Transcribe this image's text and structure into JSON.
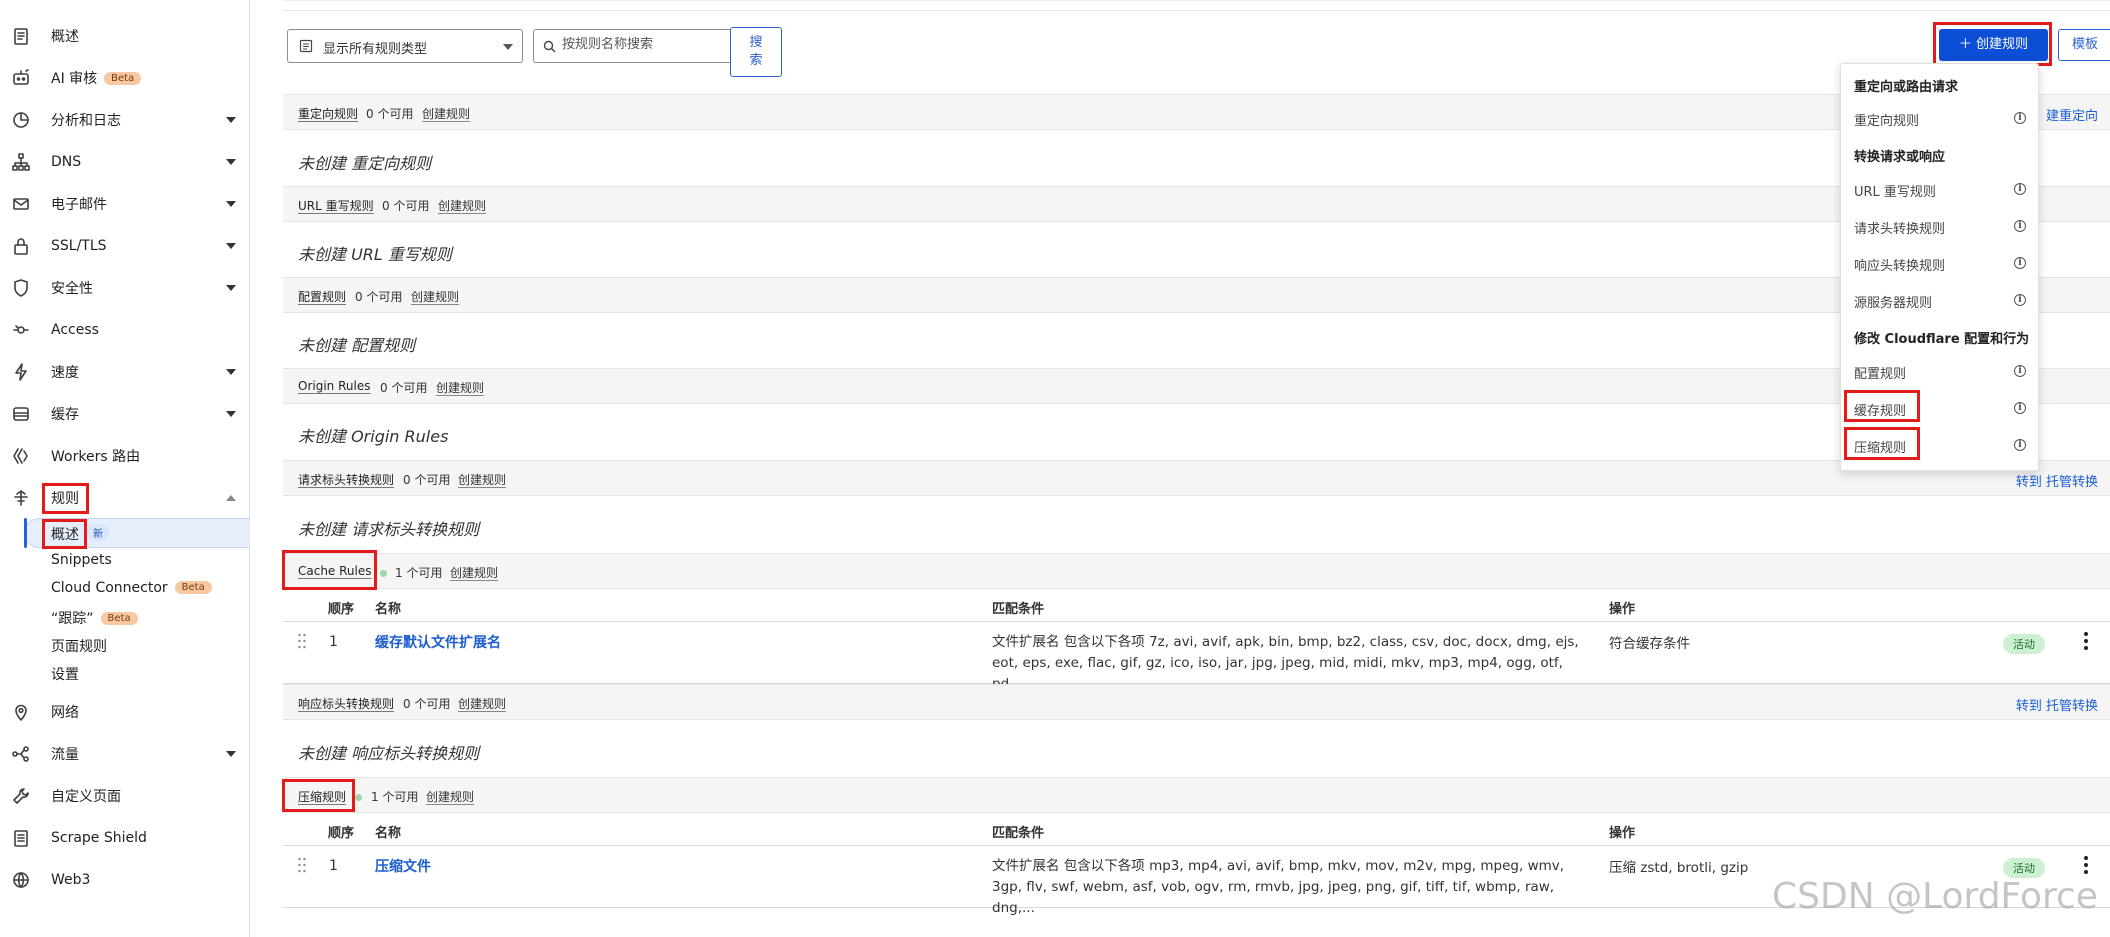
{
  "sidebar": {
    "items": [
      {
        "label": "概述"
      },
      {
        "label": "AI 审核",
        "badge": "Beta"
      },
      {
        "label": "分析和日志"
      },
      {
        "label": "DNS"
      },
      {
        "label": "电子邮件"
      },
      {
        "label": "SSL/TLS"
      },
      {
        "label": "安全性"
      },
      {
        "label": "Access"
      },
      {
        "label": "速度"
      },
      {
        "label": "缓存"
      },
      {
        "label": "Workers 路由"
      },
      {
        "label": "规则"
      },
      {
        "label": "网络"
      },
      {
        "label": "流量"
      },
      {
        "label": "自定义页面"
      },
      {
        "label": "Scrape Shield"
      },
      {
        "label": "Web3"
      }
    ],
    "rules_sub": [
      {
        "label": "概述",
        "badge": "新"
      },
      {
        "label": "Snippets"
      },
      {
        "label": "Cloud Connector",
        "badge": "Beta"
      },
      {
        "label": "“跟踪”",
        "badge": "Beta"
      },
      {
        "label": "页面规则"
      },
      {
        "label": "设置"
      }
    ]
  },
  "toolbar": {
    "filter_value": "显示所有规则类型",
    "search_placeholder": "按规则名称搜索",
    "search_button": "搜索",
    "create_button": "＋ 创建规则",
    "template_button": "模板"
  },
  "sections": [
    {
      "name": "重定向规则",
      "avail": "0 个可用",
      "create": "创建规则",
      "empty": "未创建 重定向规则",
      "right_link": "建重定向"
    },
    {
      "name": "URL 重写规则",
      "avail": "0 个可用",
      "create": "创建规则",
      "empty": "未创建 URL 重写规则"
    },
    {
      "name": "配置规则",
      "avail": "0 个可用",
      "create": "创建规则",
      "empty": "未创建 配置规则"
    },
    {
      "name": "Origin Rules",
      "avail": "0 个可用",
      "create": "创建规则",
      "empty": "未创建 Origin Rules"
    },
    {
      "name": "请求标头转换规则",
      "avail": "0 个可用",
      "create": "创建规则",
      "empty": "未创建 请求标头转换规则",
      "right_link": "转到 托管转换"
    },
    {
      "name": "Cache Rules",
      "avail": "1 个可用",
      "create": "创建规则"
    },
    {
      "name": "响应标头转换规则",
      "avail": "0 个可用",
      "create": "创建规则",
      "empty": "未创建 响应标头转换规则",
      "right_link": "转到 托管转换"
    },
    {
      "name": "压缩规则",
      "avail": "1 个可用",
      "create": "创建规则"
    }
  ],
  "table_headers": {
    "order": "顺序",
    "name": "名称",
    "match": "匹配条件",
    "action": "操作"
  },
  "cache_rule": {
    "order": "1",
    "name": "缓存默认文件扩展名",
    "cond_line1": "文件扩展名 包含以下各项 7z, avi, avif, apk, bin, bmp, bz2, class, csv, doc, docx, dmg, ejs,",
    "cond_line2": "eot, eps, exe, flac, gif, gz, ico, iso, jar, jpg, jpeg, mid, midi, mkv, mp3, mp4, ogg, otf, pd...",
    "action": "符合缓存条件",
    "status": "活动"
  },
  "compress_rule": {
    "order": "1",
    "name": "压缩文件",
    "cond_line1": "文件扩展名 包含以下各项 mp3, mp4, avi, avif, bmp, mkv, mov, m2v, mpg, mpeg, wmv,",
    "cond_line2": "3gp, flv, swf, webm, asf, vob, ogv, rm, rmvb, jpg, jpeg, png, gif, tiff, tif, wbmp, raw, dng,...",
    "action": "压缩 zstd, brotli, gzip",
    "status": "活动"
  },
  "dropdown": {
    "group1": "重定向或路由请求",
    "item_redirect": "重定向规则",
    "group2": "转换请求或响应",
    "item_url": "URL 重写规则",
    "item_req": "请求头转换规则",
    "item_resp": "响应头转换规则",
    "item_origin": "源服务器规则",
    "group3": "修改 Cloudflare 配置和行为",
    "item_config": "配置规则",
    "item_cache": "缓存规则",
    "item_compress": "压缩规则",
    "info": "i"
  },
  "watermark": "CSDN @LordForce",
  "colors": {
    "accent": "#0c4fd6",
    "link": "#1c5dd1",
    "highlight": "#e21b1b",
    "status_bg": "#cdf0d2"
  }
}
